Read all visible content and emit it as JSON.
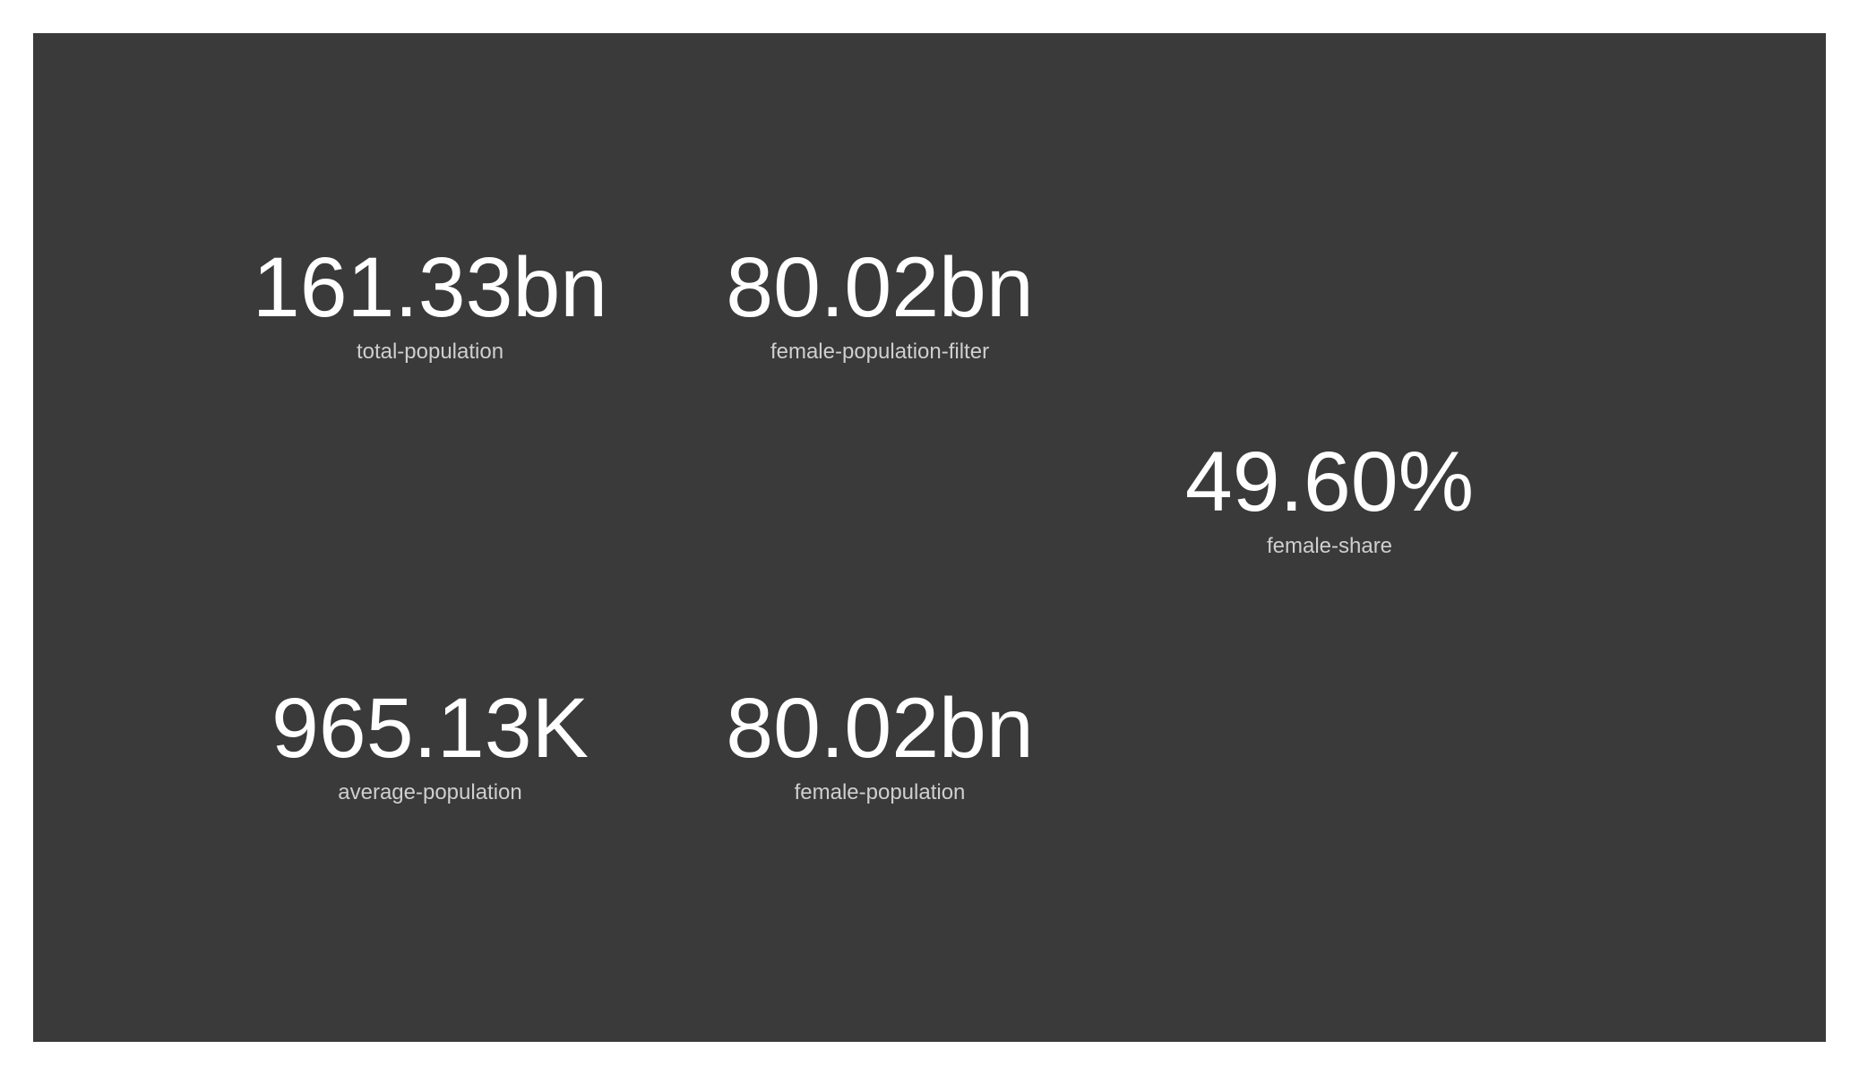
{
  "dashboard": {
    "background_color": "#3a3a3a",
    "value_color": "#ffffff",
    "label_color": "#cfcfcf",
    "cards": {
      "total_population": {
        "value": "161.33bn",
        "label": "total-population"
      },
      "female_population_filter": {
        "value": "80.02bn",
        "label": "female-population-filter"
      },
      "female_share": {
        "value": "49.60%",
        "label": "female-share"
      },
      "average_population": {
        "value": "965.13K",
        "label": "average-population"
      },
      "female_population": {
        "value": "80.02bn",
        "label": "female-population"
      }
    }
  }
}
